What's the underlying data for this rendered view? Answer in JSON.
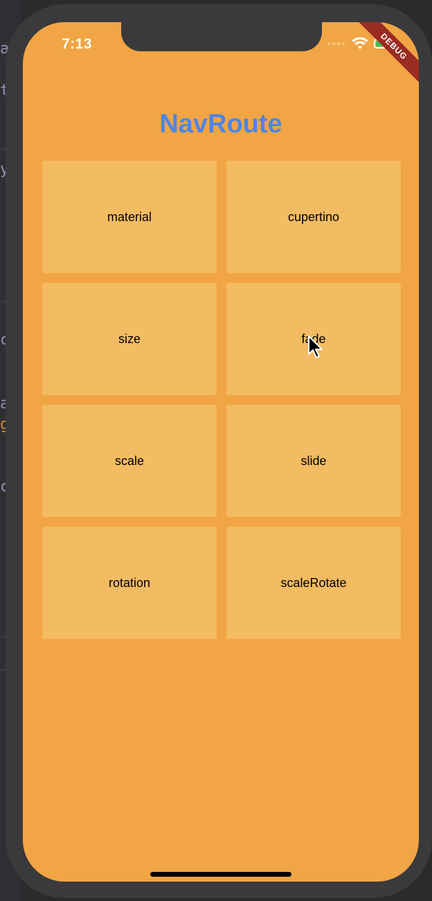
{
  "status_bar": {
    "time": "7:13",
    "debug_label": "DEBUG"
  },
  "app": {
    "title": "NavRoute",
    "title_color": "#4c86e6",
    "background_color": "#f1a544",
    "tile_color": "#f3bb62"
  },
  "buttons": [
    {
      "label": "material"
    },
    {
      "label": "cupertino"
    },
    {
      "label": "size"
    },
    {
      "label": "fade"
    },
    {
      "label": "scale"
    },
    {
      "label": "slide"
    },
    {
      "label": "rotation"
    },
    {
      "label": "scaleRotate"
    }
  ],
  "background_editor": {
    "fragments": [
      "a",
      "t",
      "y",
      "c",
      "a",
      "g",
      "c"
    ]
  }
}
